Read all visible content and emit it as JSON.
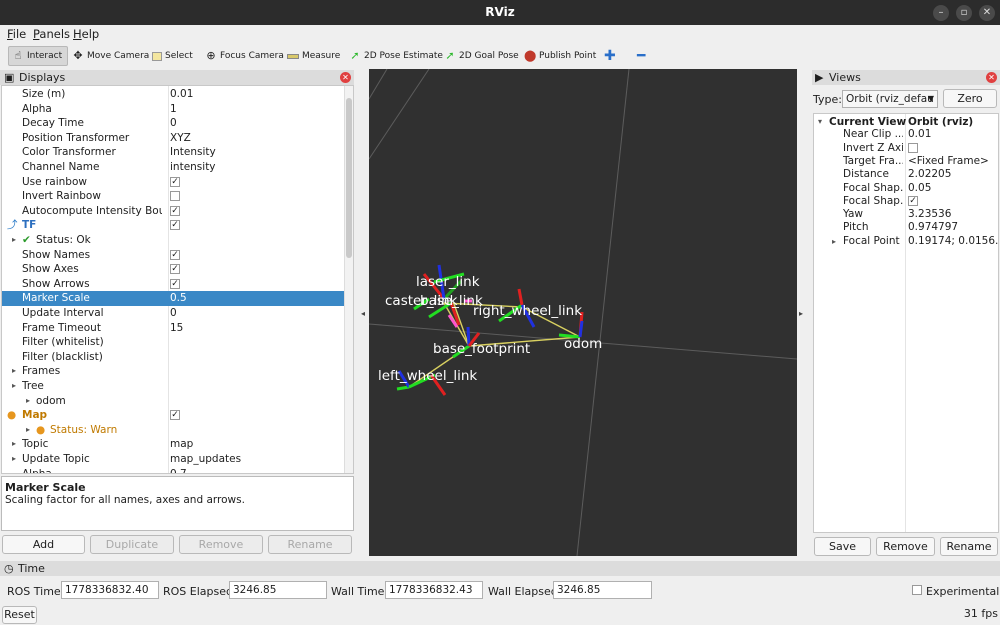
{
  "window": {
    "title": "RViz"
  },
  "menu": {
    "file": "File",
    "panels": "Panels",
    "help": "Help"
  },
  "toolbar": {
    "interact": "Interact",
    "move_camera": "Move Camera",
    "select": "Select",
    "focus_camera": "Focus Camera",
    "measure": "Measure",
    "pose_estimate": "2D Pose Estimate",
    "goal_pose": "2D Goal Pose",
    "publish_point": "Publish Point"
  },
  "displays": {
    "title": "Displays",
    "rows": [
      {
        "key": "Size (m)",
        "value": "0.01"
      },
      {
        "key": "Alpha",
        "value": "1"
      },
      {
        "key": "Decay Time",
        "value": "0"
      },
      {
        "key": "Position Transformer",
        "value": "XYZ"
      },
      {
        "key": "Color Transformer",
        "value": "Intensity"
      },
      {
        "key": "Channel Name",
        "value": "intensity"
      },
      {
        "key": "Use rainbow",
        "value": "✓"
      },
      {
        "key": "Invert Rainbow",
        "value": ""
      },
      {
        "key": "Autocompute Intensity Bou...",
        "value": "✓"
      },
      {
        "key": "TF",
        "value": "✓"
      },
      {
        "key": "Status: Ok",
        "value": ""
      },
      {
        "key": "Show Names",
        "value": "✓"
      },
      {
        "key": "Show Axes",
        "value": "✓"
      },
      {
        "key": "Show Arrows",
        "value": "✓"
      },
      {
        "key": "Marker Scale",
        "value": "0.5"
      },
      {
        "key": "Update Interval",
        "value": "0"
      },
      {
        "key": "Frame Timeout",
        "value": "15"
      },
      {
        "key": "Filter (whitelist)",
        "value": ""
      },
      {
        "key": "Filter (blacklist)",
        "value": ""
      },
      {
        "key": "Frames",
        "value": ""
      },
      {
        "key": "Tree",
        "value": ""
      },
      {
        "key": "odom",
        "value": ""
      },
      {
        "key": "Map",
        "value": "✓"
      },
      {
        "key": "Status: Warn",
        "value": ""
      },
      {
        "key": "Topic",
        "value": "map"
      },
      {
        "key": "Update Topic",
        "value": "map_updates"
      },
      {
        "key": "Alpha",
        "value": "0.7"
      }
    ],
    "desc_title": "Marker Scale",
    "desc_text": "Scaling factor for all names, axes and arrows.",
    "buttons": {
      "add": "Add",
      "duplicate": "Duplicate",
      "remove": "Remove",
      "rename": "Rename"
    }
  },
  "viewport": {
    "labels": {
      "laser": "laser_link",
      "caster": "caster_link",
      "base_link": "base_link",
      "right_wheel": "right_wheel_link",
      "base_footprint": "base_footprint",
      "odom": "odom",
      "left_wheel": "left_wheel_link"
    }
  },
  "views": {
    "title": "Views",
    "type_label": "Type:",
    "type_value": "Orbit (rviz_defau",
    "zero": "Zero",
    "header_key": "Current View",
    "header_value": "Orbit (rviz)",
    "rows": [
      {
        "key": "Near Clip ...",
        "value": "0.01"
      },
      {
        "key": "Invert Z Axis",
        "value": ""
      },
      {
        "key": "Target Fra...",
        "value": "<Fixed Frame>"
      },
      {
        "key": "Distance",
        "value": "2.02205"
      },
      {
        "key": "Focal Shap...",
        "value": "0.05"
      },
      {
        "key": "Focal Shap...",
        "value": "✓"
      },
      {
        "key": "Yaw",
        "value": "3.23536"
      },
      {
        "key": "Pitch",
        "value": "0.974797"
      },
      {
        "key": "Focal Point",
        "value": "0.19174; 0.0156..."
      }
    ],
    "buttons": {
      "save": "Save",
      "remove": "Remove",
      "rename": "Rename"
    }
  },
  "time": {
    "title": "Time",
    "ros_time_label": "ROS Time:",
    "ros_time": "1778336832.40",
    "ros_elapsed_label": "ROS Elapsed:",
    "ros_elapsed": "3246.85",
    "wall_time_label": "Wall Time:",
    "wall_time": "1778336832.43",
    "wall_elapsed_label": "Wall Elapsed:",
    "wall_elapsed": "3246.85",
    "experimental": "Experimental",
    "reset": "Reset",
    "fps": "31 fps"
  }
}
